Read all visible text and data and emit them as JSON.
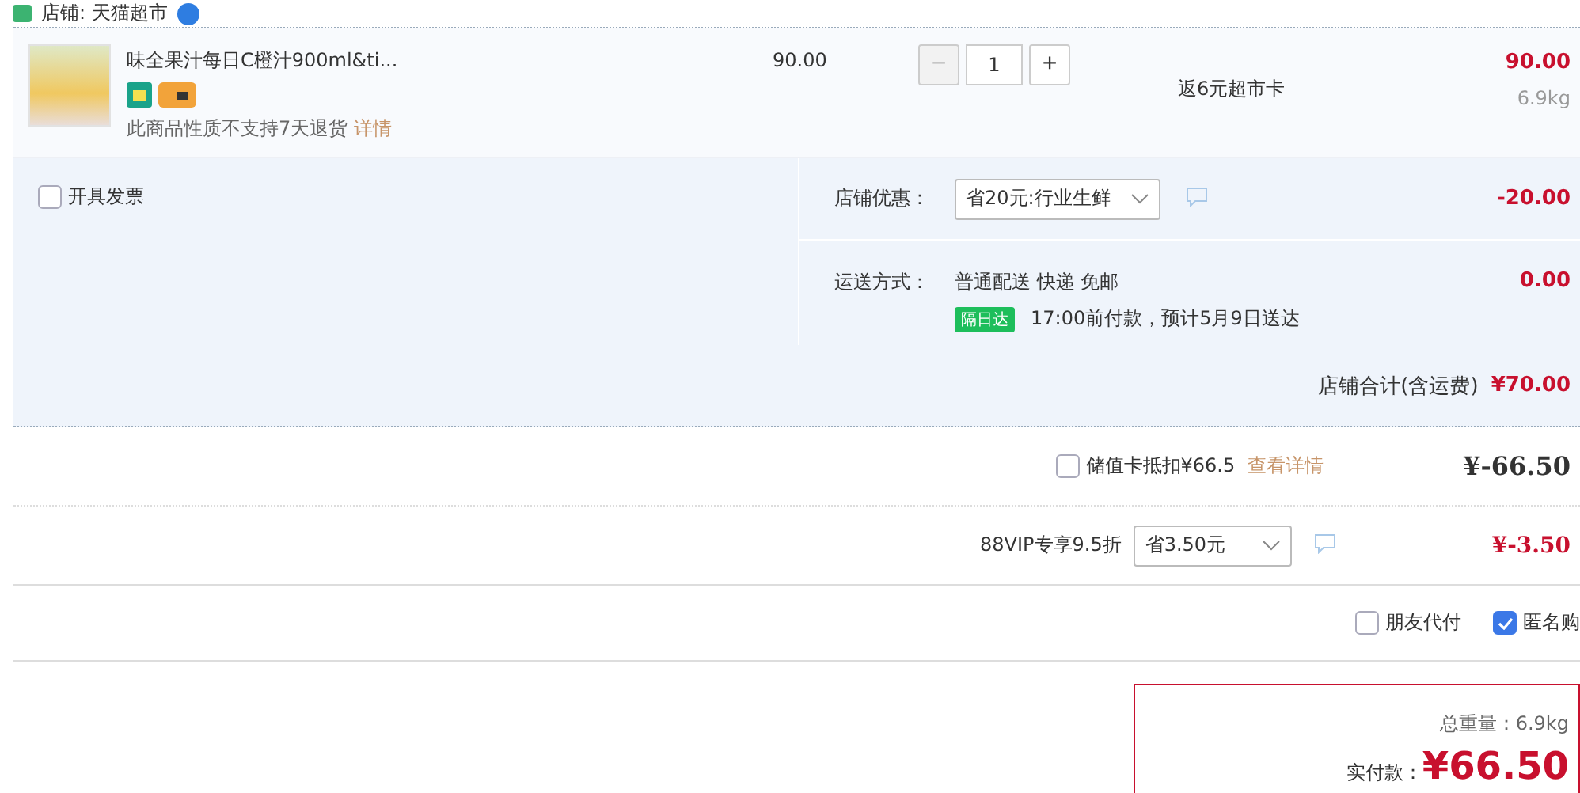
{
  "shop": {
    "label": "店铺: 天猫超市"
  },
  "item": {
    "title": "味全果汁每日C橙汁900ml&ti...",
    "notice": "此商品性质不支持7天退货",
    "notice_link": "详情",
    "unit_price": "90.00",
    "quantity": "1",
    "minus": "−",
    "plus": "+",
    "promo": "返6元超市卡",
    "total": "90.00",
    "weight": "6.9kg"
  },
  "invoice": {
    "label": "开具发票",
    "checked": false
  },
  "discount": {
    "label": "店铺优惠：",
    "option": "省20元:行业生鲜",
    "amount": "-20.00"
  },
  "shipping": {
    "label": "运送方式：",
    "method": "普通配送 快递 免邮",
    "badge": "隔日达",
    "eta": "17:00前付款，预计5月9日送达",
    "amount": "0.00"
  },
  "shop_total": {
    "label": "店铺合计(含运费)",
    "amount": "¥70.00"
  },
  "stored_card": {
    "label": "储值卡抵扣¥66.5",
    "link": "查看详情",
    "checked": false,
    "amount": "¥-66.50"
  },
  "vip": {
    "label": "88VIP专享9.5折",
    "option": "省3.50元",
    "amount": "¥-3.50"
  },
  "options": [
    {
      "label": "朋友代付",
      "checked": false
    },
    {
      "label": "匿名购",
      "checked": true
    }
  ],
  "summary": {
    "weight": "总重量：6.9kg",
    "pay_label": "实付款：",
    "pay_amount": "¥66.50"
  }
}
